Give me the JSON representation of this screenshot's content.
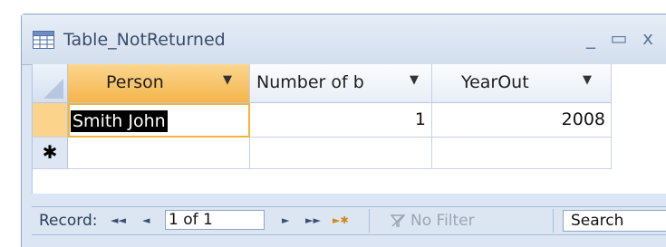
{
  "window": {
    "title": "Table_NotReturned",
    "minimize": "_",
    "maximize": "▭",
    "close": "x"
  },
  "columns": [
    {
      "label": "Person",
      "filter_arrow": "▼"
    },
    {
      "label": "Number of b",
      "filter_arrow": "▼"
    },
    {
      "label": "YearOut",
      "filter_arrow": "▼"
    }
  ],
  "rows": [
    {
      "person": "Smith John",
      "number": "1",
      "year": "2008"
    }
  ],
  "new_record_marker": "✱",
  "navigation": {
    "record_label": "Record:",
    "first": "◄◄",
    "prev": "◄",
    "position": "1 of 1",
    "next": "►",
    "last": "►►",
    "new": "►✱",
    "filter_label": "No Filter",
    "search_placeholder": "Search"
  },
  "colors": {
    "selected_header": "#f5b54d",
    "accent_border": "#f3b33d",
    "window_bg": "#dbe5f3"
  }
}
